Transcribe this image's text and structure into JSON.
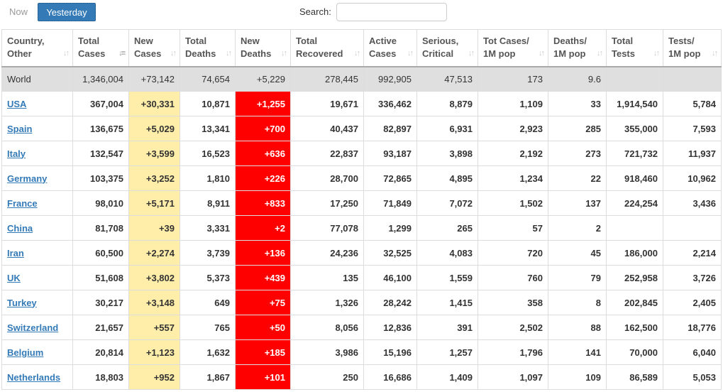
{
  "toolbar": {
    "now_label": "Now",
    "yesterday_label": "Yesterday",
    "search_label": "Search:",
    "search_value": ""
  },
  "columns": [
    [
      "Country,",
      "Other"
    ],
    [
      "Total",
      "Cases"
    ],
    [
      "New",
      "Cases"
    ],
    [
      "Total",
      "Deaths"
    ],
    [
      "New",
      "Deaths"
    ],
    [
      "Total",
      "Recovered"
    ],
    [
      "Active",
      "Cases"
    ],
    [
      "Serious,",
      "Critical"
    ],
    [
      "Tot Cases/",
      "1M pop"
    ],
    [
      "Deaths/",
      "1M pop"
    ],
    [
      "Total",
      "Tests"
    ],
    [
      "Tests/",
      "1M pop"
    ]
  ],
  "world": [
    "World",
    "1,346,004",
    "+73,142",
    "74,654",
    "+5,229",
    "278,445",
    "992,905",
    "47,513",
    "173",
    "9.6",
    "",
    ""
  ],
  "rows": [
    [
      "USA",
      "367,004",
      "+30,331",
      "10,871",
      "+1,255",
      "19,671",
      "336,462",
      "8,879",
      "1,109",
      "33",
      "1,914,540",
      "5,784"
    ],
    [
      "Spain",
      "136,675",
      "+5,029",
      "13,341",
      "+700",
      "40,437",
      "82,897",
      "6,931",
      "2,923",
      "285",
      "355,000",
      "7,593"
    ],
    [
      "Italy",
      "132,547",
      "+3,599",
      "16,523",
      "+636",
      "22,837",
      "93,187",
      "3,898",
      "2,192",
      "273",
      "721,732",
      "11,937"
    ],
    [
      "Germany",
      "103,375",
      "+3,252",
      "1,810",
      "+226",
      "28,700",
      "72,865",
      "4,895",
      "1,234",
      "22",
      "918,460",
      "10,962"
    ],
    [
      "France",
      "98,010",
      "+5,171",
      "8,911",
      "+833",
      "17,250",
      "71,849",
      "7,072",
      "1,502",
      "137",
      "224,254",
      "3,436"
    ],
    [
      "China",
      "81,708",
      "+39",
      "3,331",
      "+2",
      "77,078",
      "1,299",
      "265",
      "57",
      "2",
      "",
      ""
    ],
    [
      "Iran",
      "60,500",
      "+2,274",
      "3,739",
      "+136",
      "24,236",
      "32,525",
      "4,083",
      "720",
      "45",
      "186,000",
      "2,214"
    ],
    [
      "UK",
      "51,608",
      "+3,802",
      "5,373",
      "+439",
      "135",
      "46,100",
      "1,559",
      "760",
      "79",
      "252,958",
      "3,726"
    ],
    [
      "Turkey",
      "30,217",
      "+3,148",
      "649",
      "+75",
      "1,326",
      "28,242",
      "1,415",
      "358",
      "8",
      "202,845",
      "2,405"
    ],
    [
      "Switzerland",
      "21,657",
      "+557",
      "765",
      "+50",
      "8,056",
      "12,836",
      "391",
      "2,502",
      "88",
      "162,500",
      "18,776"
    ],
    [
      "Belgium",
      "20,814",
      "+1,123",
      "1,632",
      "+185",
      "3,986",
      "15,196",
      "1,257",
      "1,796",
      "141",
      "70,000",
      "6,040"
    ],
    [
      "Netherlands",
      "18,803",
      "+952",
      "1,867",
      "+101",
      "250",
      "16,686",
      "1,409",
      "1,097",
      "109",
      "86,589",
      "5,053"
    ]
  ]
}
